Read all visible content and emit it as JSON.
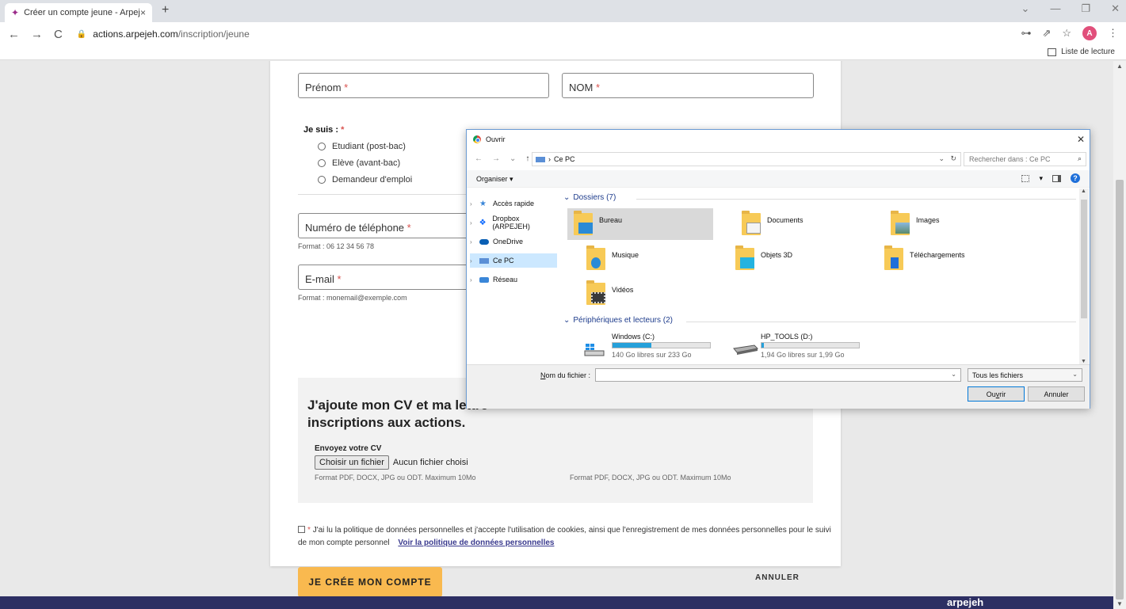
{
  "browser": {
    "tab_title": "Créer un compte jeune - Arpejeh",
    "tab_close": "×",
    "new_tab": "+",
    "url_host": "actions.arpejeh.com",
    "url_path": "/inscription/jeune",
    "profile_initial": "A",
    "reading_list": "Liste de lecture",
    "nav_back": "←",
    "nav_forward": "→",
    "nav_reload": "C",
    "win_minimize": "—",
    "win_maximize": "❐",
    "win_close": "✕",
    "win_menu": "⌄",
    "icon_key": "⊶",
    "icon_share": "⇗",
    "icon_star": "☆",
    "icon_more": "⋮"
  },
  "form": {
    "prenom_label": "Prénom",
    "nom_label": "NOM",
    "required_mark": "*",
    "je_suis_label": "Je suis :",
    "status_options": [
      "Etudiant (post-bac)",
      "Elève (avant-bac)",
      "Demandeur d'emploi"
    ],
    "phone_label": "Numéro de téléphone",
    "phone_hint": "Format : 06 12 34 56 78",
    "email_label": "E-mail",
    "email_hint": "Format : monemail@exemple.com",
    "cv_title_line1": "J'ajoute mon CV et ma lettre",
    "cv_title_line2": "inscriptions aux actions.",
    "cv_send_label": "Envoyez votre CV",
    "choose_file": "Choisir un fichier",
    "no_file": "Aucun fichier choisi",
    "file_format_hint": "Format PDF, DOCX, JPG ou ODT. Maximum 10Mo",
    "consent_text": "J'ai lu la politique de données personnelles et j'accepte l'utilisation de cookies, ainsi que l'enregistrement de mes données personnelles pour le suivi de mon compte personnel",
    "consent_link": "Voir la politique de données personnelles",
    "create_button": "JE CRÉE MON COMPTE",
    "cancel_button": "ANNULER"
  },
  "footer": {
    "logo_text": "arpejeh"
  },
  "dialog": {
    "title": "Ouvrir",
    "close": "✕",
    "nav_back": "←",
    "nav_forward": "→",
    "nav_recent": "⌄",
    "nav_up": "↑",
    "address_sep": "›",
    "address": "Ce PC",
    "address_dropdown": "⌄",
    "refresh": "↻",
    "search_placeholder": "Rechercher dans : Ce PC",
    "search_icon": "⌕",
    "organiser": "Organiser ▾",
    "view_dropdown": "▾",
    "help": "?",
    "nav_chevron": "›",
    "group_chevron": "⌄",
    "nav_items": [
      {
        "label": "Accès rapide",
        "icon": "star-icon",
        "color": "#3a86d8"
      },
      {
        "label": "Dropbox (ARPEJEH)",
        "icon": "dropbox-icon",
        "color": "#0061fe"
      },
      {
        "label": "OneDrive",
        "icon": "cloud-icon",
        "color": "#0a5fb4"
      },
      {
        "label": "Ce PC",
        "icon": "computer-icon",
        "color": "#5b8fd6"
      },
      {
        "label": "Réseau",
        "icon": "network-icon",
        "color": "#3a86d8"
      }
    ],
    "folders_group": "Dossiers (7)",
    "folders": [
      {
        "name": "Bureau",
        "icon": "desktop-folder-icon"
      },
      {
        "name": "Documents",
        "icon": "documents-folder-icon"
      },
      {
        "name": "Images",
        "icon": "images-folder-icon"
      },
      {
        "name": "Musique",
        "icon": "music-folder-icon"
      },
      {
        "name": "Objets 3D",
        "icon": "3d-objects-folder-icon"
      },
      {
        "name": "Téléchargements",
        "icon": "downloads-folder-icon"
      },
      {
        "name": "Vidéos",
        "icon": "videos-folder-icon"
      }
    ],
    "drives_group": "Périphériques et lecteurs (2)",
    "drives": [
      {
        "name": "Windows (C:)",
        "space": "140 Go libres sur 233 Go",
        "used_fraction": 0.4
      },
      {
        "name": "HP_TOOLS (D:)",
        "space": "1,94 Go libres sur 1,99 Go",
        "used_fraction": 0.025
      }
    ],
    "filename_label_pre": "N",
    "filename_label_post": "om du fichier :",
    "filename_dropdown": "⌄",
    "filetype": "Tous les fichiers",
    "filetype_dropdown": "⌄",
    "open_pre": "Ou",
    "open_key": "v",
    "open_post": "rir",
    "cancel": "Annuler",
    "scroll_up": "▲",
    "scroll_down": "▼"
  },
  "page_scroll": {
    "up": "▲",
    "down": "▼"
  }
}
